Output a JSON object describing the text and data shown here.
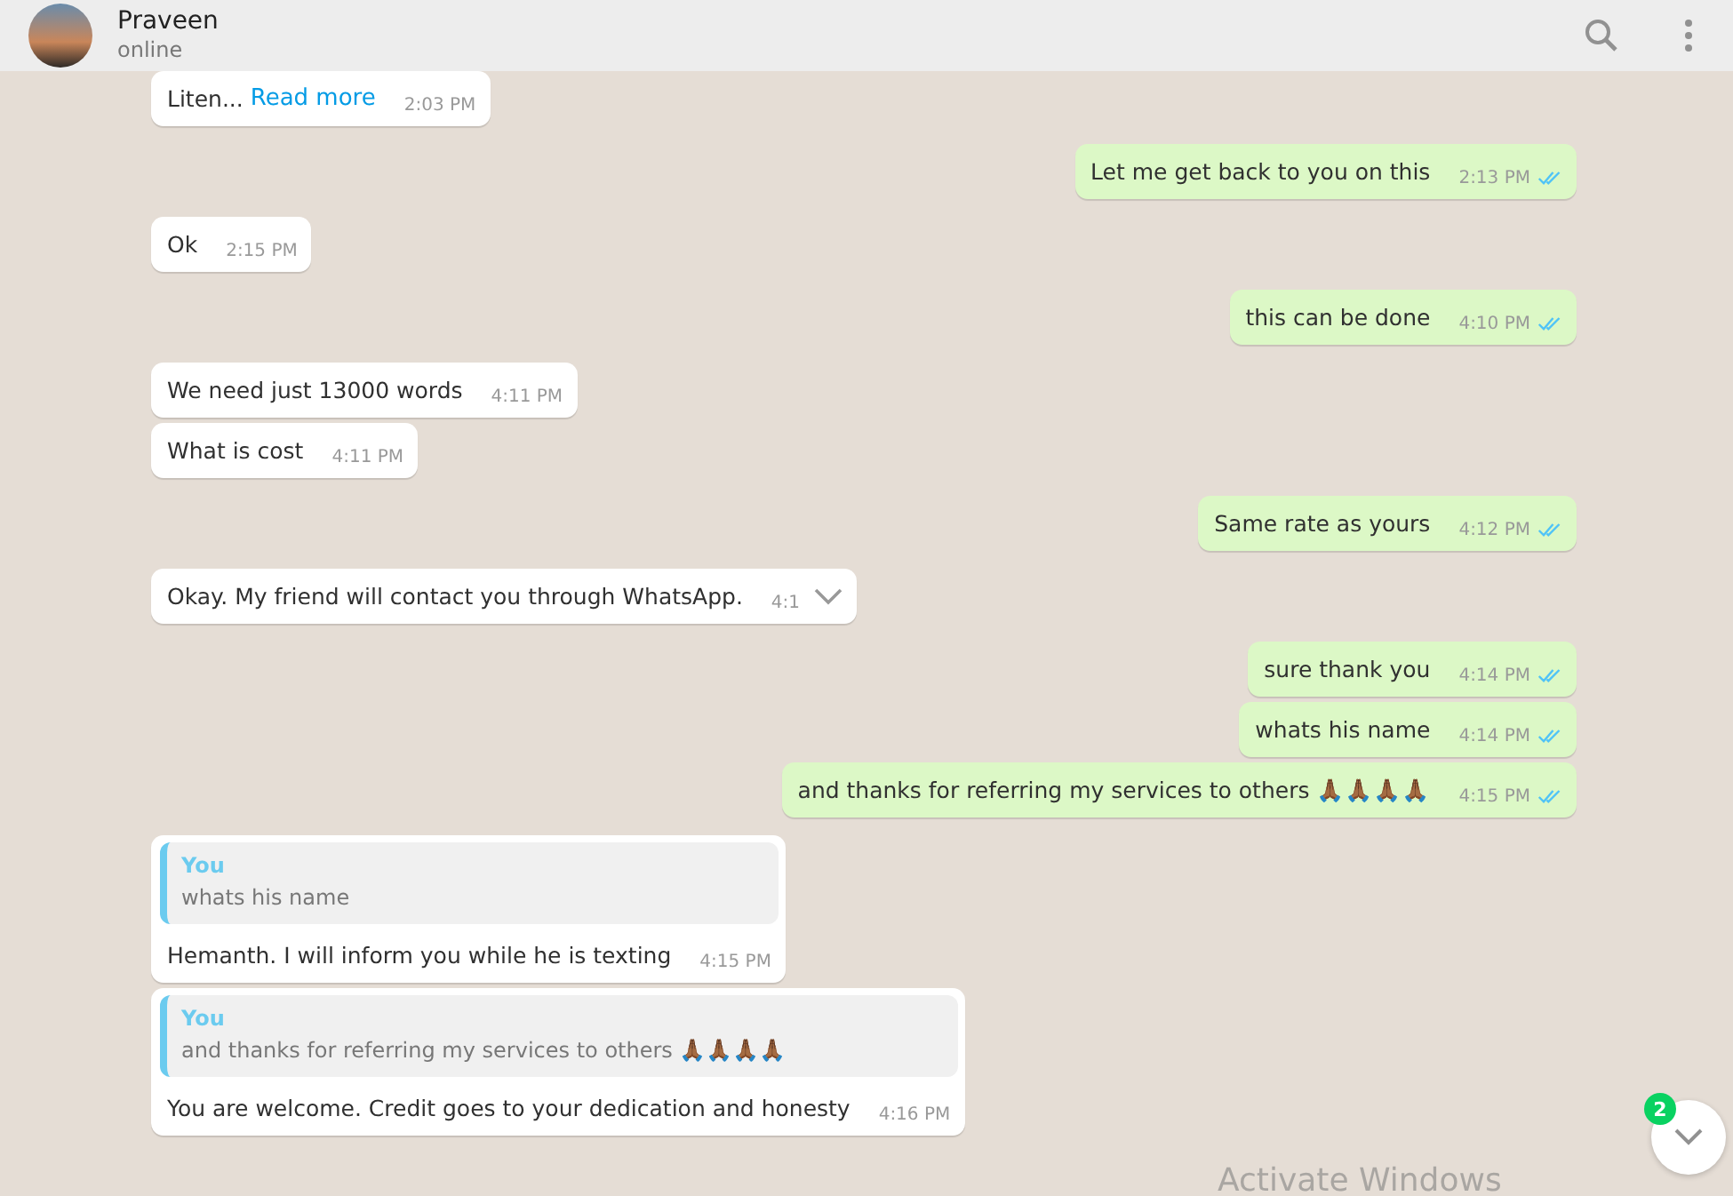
{
  "header": {
    "name": "Praveen",
    "status": "online"
  },
  "messages": [
    {
      "kind": "incoming",
      "text": "Liten...",
      "link": "Read more",
      "time": "2:03 PM"
    },
    {
      "kind": "outgoing",
      "text": "Let me get back to you on this",
      "time": "2:13 PM",
      "read": true
    },
    {
      "kind": "incoming",
      "text": "Ok",
      "time": "2:15 PM"
    },
    {
      "kind": "outgoing",
      "text": "this can be done",
      "time": "4:10 PM",
      "read": true
    },
    {
      "kind": "incoming",
      "text": "We need just 13000 words",
      "time": "4:11 PM"
    },
    {
      "kind": "incoming",
      "text": "What is cost",
      "time": "4:11 PM"
    },
    {
      "kind": "outgoing",
      "text": "Same rate as yours",
      "time": "4:12 PM",
      "read": true
    },
    {
      "kind": "incoming",
      "text": "Okay. My friend will contact you through WhatsApp.",
      "time": "4:1",
      "menu": true
    },
    {
      "kind": "outgoing",
      "text": "sure thank you",
      "time": "4:14 PM",
      "read": true
    },
    {
      "kind": "outgoing",
      "text": "whats his name",
      "time": "4:14 PM",
      "read": true
    },
    {
      "kind": "outgoing",
      "text": "and thanks for referring my services to others 🙏🏾🙏🏾🙏🏾🙏🏾",
      "time": "4:15 PM",
      "read": true
    },
    {
      "kind": "incoming",
      "quote": {
        "author": "You",
        "text": "whats his name"
      },
      "text": "Hemanth. I will inform you while he is texting",
      "time": "4:15 PM"
    },
    {
      "kind": "incoming",
      "quote": {
        "author": "You",
        "text": "and thanks for referring my services to others 🙏🏾🙏🏾🙏🏾🙏🏾"
      },
      "text": "You are welcome. Credit goes to your dedication and honesty",
      "time": "4:16 PM"
    }
  ],
  "scroll_button": {
    "badge": "2"
  },
  "os_notice": "Activate Windows"
}
